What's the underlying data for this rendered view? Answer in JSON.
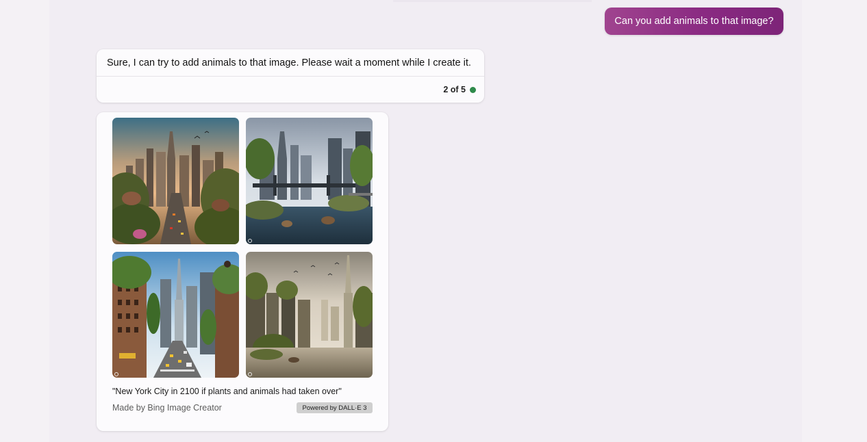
{
  "user_message": {
    "text": "Can you add animals to that image?"
  },
  "bot_message": {
    "text": "Sure, I can try to add animals to that image. Please wait a moment while I create it.",
    "counter": "2 of 5",
    "status_color": "#2f8a4b"
  },
  "image_card": {
    "images": [
      {
        "icon": "generated-image-city-sunset-animals"
      },
      {
        "icon": "generated-image-bridge-flooded-city"
      },
      {
        "icon": "generated-image-overgrown-avenue-traffic"
      },
      {
        "icon": "generated-image-flooded-skyline-birds"
      }
    ],
    "prompt": "\"New York City in 2100 if plants and animals had taken over\"",
    "made_by": "Made by Bing Image Creator",
    "powered_by": "Powered by DALL·E 3"
  },
  "colors": {
    "user_bubble_start": "#a0448f",
    "user_bubble_end": "#7d2478",
    "background": "#f1edf3",
    "card": "#fcfbfd"
  }
}
